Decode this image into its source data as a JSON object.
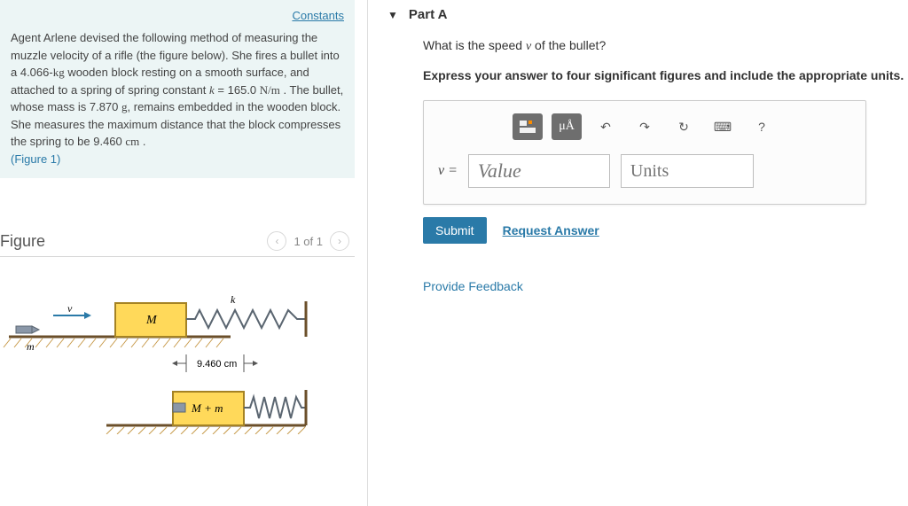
{
  "left": {
    "constants_label": "Constants",
    "problem_html": "Agent Arlene devised the following method of measuring the muzzle velocity of a rifle (the figure below). She fires a bullet into a 4.066-kg wooden block resting on a smooth surface, and attached to a spring of spring constant k = 165.0 N/m . The bullet, whose mass is 7.870 g, remains embedded in the wooden block. She measures the maximum distance that the block compresses the spring to be 9.460 cm .",
    "figure_link": "(Figure 1)",
    "figure": {
      "heading": "Figure",
      "page": "1 of 1",
      "labels": {
        "m": "m",
        "M": "M",
        "k": "k",
        "dist": "9.460 cm",
        "Mm": "M + m",
        "v": "v"
      }
    }
  },
  "right": {
    "part_label": "Part A",
    "question": "What is the speed v of the bullet?",
    "instruction": "Express your answer to four significant figures and include the appropriate units.",
    "toolbar": {
      "templates": "templates-icon",
      "special": "μÅ",
      "undo": "↶",
      "redo": "↷",
      "reset": "↻",
      "keyboard": "⌨",
      "help": "?"
    },
    "eq_label": "v =",
    "value_placeholder": "Value",
    "units_placeholder": "Units",
    "submit_label": "Submit",
    "request_label": "Request Answer",
    "feedback_label": "Provide Feedback"
  }
}
